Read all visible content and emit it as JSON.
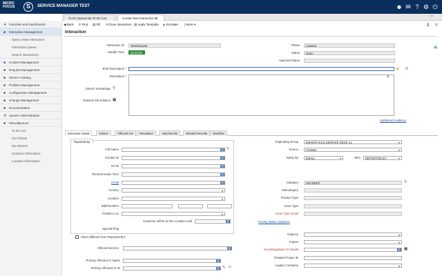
{
  "topbar": {
    "logo_line1": "MICRO",
    "logo_line2": "FOCUS",
    "logo_glyph": "S",
    "app_title": "SERVICE MANAGER TEST",
    "icons": [
      "user-icon",
      "mail-icon",
      "help-icon",
      "settings-icon",
      "power-icon"
    ]
  },
  "tabs": [
    {
      "label": "To Do Queue:My To Do List"
    },
    {
      "label": "Create New Interaction"
    }
  ],
  "toolbar": {
    "back": "Back",
    "find": "Find",
    "fill": "Fill",
    "close": "Close Interaction",
    "template": "Apply Template",
    "escalate": "Escalate",
    "more": "More"
  },
  "sidebar": [
    {
      "label": "Favorites and Dashboards"
    },
    {
      "label": "Interaction Management"
    },
    {
      "label": "Open a New Interaction"
    },
    {
      "label": "Interaction Queue"
    },
    {
      "label": "Search Interactions"
    },
    {
      "label": "Incident Management"
    },
    {
      "label": "Request Management"
    },
    {
      "label": "Service Catalog"
    },
    {
      "label": "Problem Management"
    },
    {
      "label": "Configuration Management"
    },
    {
      "label": "Change Management"
    },
    {
      "label": "Documentation"
    },
    {
      "label": "System Administration"
    },
    {
      "label": "Miscellaneous"
    },
    {
      "label": "To Do List"
    },
    {
      "label": "Hot Tickets"
    },
    {
      "label": "My Inboxes"
    },
    {
      "label": "Contacts Information"
    },
    {
      "label": "Location Information"
    }
  ],
  "page_title": "Interaction",
  "header": {
    "interaction_id_label": "Interaction ID",
    "interaction_id": "SD40011182",
    "handle_time_label": "Handle Time",
    "handle_time": "00:00:09",
    "phase_label": "Phase",
    "phase": "Logging",
    "status_label": "Status",
    "status": "Open",
    "approval_label": "Approval Status",
    "approval": ""
  },
  "brief_label": "Brief Description",
  "description_label": "Description",
  "search_knowledge_label": "Search Knowledge",
  "retrieve_kb_label": "Retrieve KB Solution",
  "additional_guidance": "Additional Guidance",
  "detail_tabs": [
    "Interaction Detail",
    "Actions",
    "Affected CIs",
    "Resolution",
    "Attachments",
    "Related Records",
    "Workflow"
  ],
  "reported_by": {
    "title": "Reported By",
    "full_name": "Full Name",
    "contact_id": "Contact ID",
    "nt_id": "NT ID",
    "phone": "Phone/Contact Time",
    "email": "Email",
    "country": "Country",
    "location": "Location",
    "bldg": "Bld/Floor/Rm",
    "problem_loc": "Problem Loc",
    "customer_loc": "Customer will be at this Location until",
    "special_ping": "Special Ping",
    "client_diff": "Client different from Reported By?"
  },
  "left_lower": {
    "affected_service": "Affected Service",
    "primary_ci_name": "Primary Affected CI Name",
    "primary_ci_id": "Primary Affected CI ID"
  },
  "right": {
    "orig_group_label": "Originating Group",
    "orig_group": "EMAINTI-EUS SERVICE DESK L1",
    "source_label": "Source",
    "source": "PHONE",
    "notify_label": "Notify By",
    "notify": "EMAIL",
    "who_label": "Who",
    "who": "REPORTED BY",
    "category_label": "Category",
    "category": "INCIDENT",
    "subcategory_label": "Subcategory",
    "product_type_label": "Product Type",
    "issue_type_label": "Issue Type",
    "issue_detail_label": "Issue Type Detail",
    "priority_guidance": "Priority Matrix Guidance",
    "urgency_label": "Urgency",
    "impact_label": "Impact",
    "kb_invalid_label": "KnowledgeBase ID Invalid",
    "related_project_label": "Related Project ID",
    "legacy_company_label": "Legacy Company"
  },
  "colors": {
    "topbar": "#0b2f5c",
    "accent": "#2a5f9e",
    "required": "#c0392b",
    "handle_time_bg": "#2e8b3a"
  }
}
